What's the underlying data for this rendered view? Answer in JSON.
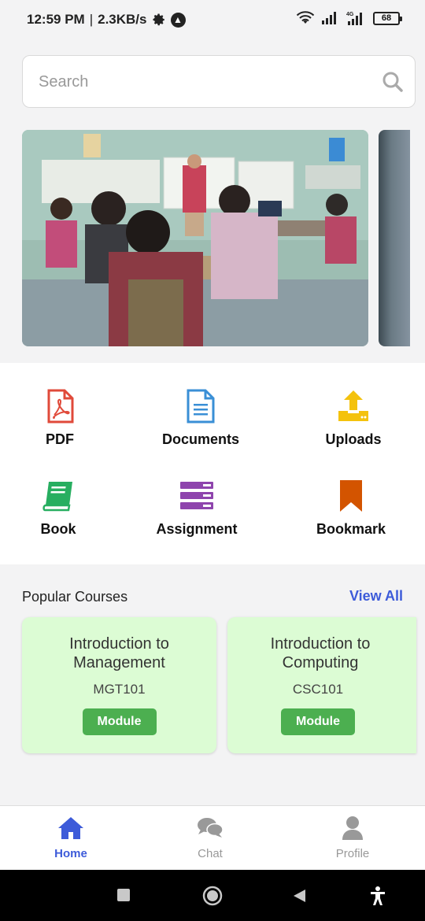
{
  "status_bar": {
    "time": "12:59 PM",
    "separator": "|",
    "net_speed": "2.3KB/s",
    "battery": "68",
    "signal_label": "4G"
  },
  "search": {
    "placeholder": "Search"
  },
  "categories": [
    {
      "label": "PDF",
      "icon": "pdf-icon",
      "color": "#e04a3a"
    },
    {
      "label": "Documents",
      "icon": "document-icon",
      "color": "#3a8fd6"
    },
    {
      "label": "Uploads",
      "icon": "upload-icon",
      "color": "#f4c20d"
    },
    {
      "label": "Book",
      "icon": "book-icon",
      "color": "#27ae60"
    },
    {
      "label": "Assignment",
      "icon": "assignment-icon",
      "color": "#8e44ad"
    },
    {
      "label": "Bookmark",
      "icon": "bookmark-icon",
      "color": "#d35400"
    }
  ],
  "popular": {
    "title": "Popular Courses",
    "view_all": "View All",
    "courses": [
      {
        "title_line1": "Introduction to",
        "title_line2": "Management",
        "code": "MGT101",
        "button": "Module"
      },
      {
        "title_line1": "Introduction to",
        "title_line2": "Computing",
        "code": "CSC101",
        "button": "Module"
      }
    ]
  },
  "bottom_nav": {
    "items": [
      {
        "label": "Home",
        "icon": "home-icon",
        "active": true
      },
      {
        "label": "Chat",
        "icon": "chat-icon",
        "active": false
      },
      {
        "label": "Profile",
        "icon": "profile-icon",
        "active": false
      }
    ]
  },
  "colors": {
    "accent": "#3d5bd9",
    "course_bg": "#dcfcd4",
    "module_button": "#4caf50",
    "inactive_nav": "#999999"
  }
}
